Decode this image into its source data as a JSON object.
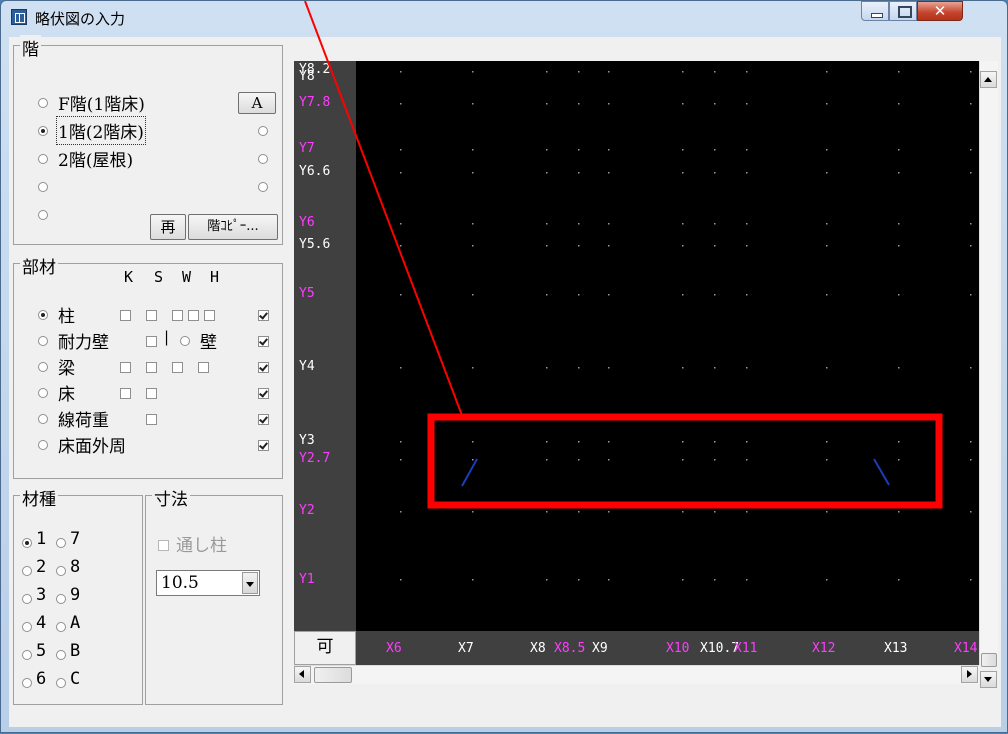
{
  "window": {
    "title": "略伏図の入力"
  },
  "floor_group": {
    "label": "階",
    "options": [
      {
        "label": "F階(1階床)",
        "checked": false
      },
      {
        "label": "1階(2階床)",
        "checked": true
      },
      {
        "label": "2階(屋根)",
        "checked": false
      },
      {
        "label": "",
        "checked": false
      },
      {
        "label": "",
        "checked": false
      }
    ],
    "right_options_checked": [
      false,
      false,
      false
    ],
    "a_button": "A",
    "redo_button": "再",
    "copy_button": "階ｺﾋﾟｰ..."
  },
  "member_group": {
    "label": "部材",
    "headers": [
      "K",
      "S",
      "W",
      "H"
    ],
    "items": [
      {
        "label": "柱",
        "checked": true
      },
      {
        "label": "耐力壁",
        "checked": false
      },
      {
        "label": "梁",
        "checked": false
      },
      {
        "label": "床",
        "checked": false
      },
      {
        "label": "線荷重",
        "checked": false
      },
      {
        "label": "床面外周",
        "checked": false
      }
    ],
    "wall_option_label": "壁",
    "separator": "|"
  },
  "material_group": {
    "label": "材種",
    "left": [
      "1",
      "2",
      "3",
      "4",
      "5",
      "6"
    ],
    "right": [
      "7",
      "8",
      "9",
      "A",
      "B",
      "C"
    ],
    "selected": "1"
  },
  "size_group": {
    "label": "寸法",
    "through_column_label": "通し柱",
    "size_value": "10.5"
  },
  "canvas": {
    "y_labels": [
      {
        "text": "Y8.2",
        "color": "#ffffff"
      },
      {
        "text": "Y8",
        "color": "#ffffff"
      },
      {
        "text": "Y7.8",
        "color": "#ff3cff"
      },
      {
        "text": "Y7",
        "color": "#ff3cff"
      },
      {
        "text": "Y6.6",
        "color": "#ffffff"
      },
      {
        "text": "Y6",
        "color": "#ff3cff"
      },
      {
        "text": "Y5.6",
        "color": "#ffffff"
      },
      {
        "text": "Y5",
        "color": "#ff3cff"
      },
      {
        "text": "Y4",
        "color": "#ffffff"
      },
      {
        "text": "Y3",
        "color": "#ffffff"
      },
      {
        "text": "Y2.7",
        "color": "#ff3cff"
      },
      {
        "text": "Y2",
        "color": "#ff3cff"
      },
      {
        "text": "Y1",
        "color": "#ff3cff"
      }
    ],
    "x_labels": [
      {
        "text": "X6",
        "color": "#ff3cff"
      },
      {
        "text": "X7",
        "color": "#ffffff"
      },
      {
        "text": "X8",
        "color": "#ffffff"
      },
      {
        "text": "X8.5",
        "color": "#ff3cff"
      },
      {
        "text": "X9",
        "color": "#ffffff"
      },
      {
        "text": "X10",
        "color": "#ff3cff"
      },
      {
        "text": "X10.7",
        "color": "#ffffff"
      },
      {
        "text": "X11",
        "color": "#ff3cff"
      },
      {
        "text": "X12",
        "color": "#ff3cff"
      },
      {
        "text": "X13",
        "color": "#ffffff"
      },
      {
        "text": "X14",
        "color": "#ff3cff"
      }
    ],
    "mode_button": "可",
    "highlight_color": "#ff0000"
  }
}
